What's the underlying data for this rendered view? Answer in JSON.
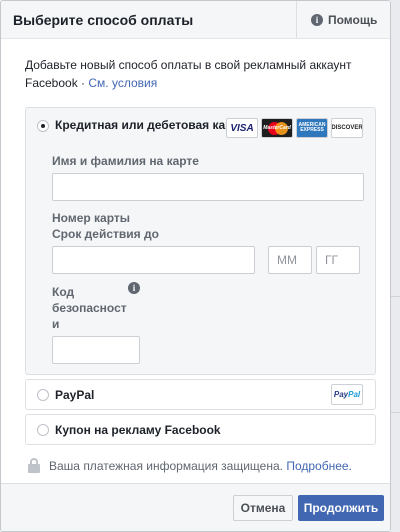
{
  "header": {
    "title": "Выберите способ оплаты",
    "help_label": "Помощь",
    "help_icon": "i"
  },
  "intro": {
    "text": "Добавьте новый способ оплаты в свой рекламный аккаунт Facebook · ",
    "terms_link": "См. условия"
  },
  "card_option": {
    "label": "Кредитная или дебетовая карта",
    "selected": true,
    "logos": {
      "visa": "VISA",
      "mastercard": "MasterCard",
      "amex_line1": "AMERICAN",
      "amex_line2": "EXPRESS",
      "discover": "DISCOVER"
    },
    "name_label": "Имя и фамилия на карте",
    "name_value": "",
    "number_label": "Номер карты",
    "expiry_label": "Срок действия до",
    "number_value": "",
    "month_placeholder": "ММ",
    "year_placeholder": "ГГ",
    "cvv_label_line1": "Код",
    "cvv_label_line2": "безопасност",
    "cvv_label_line3": "и",
    "cvv_value": "",
    "info_icon": "i"
  },
  "paypal_option": {
    "label": "PayPal",
    "selected": false,
    "logo_part1": "Pay",
    "logo_part2": "Pal"
  },
  "coupon_option": {
    "label": "Купон на рекламу Facebook",
    "selected": false
  },
  "security": {
    "text": "Ваша платежная информация защищена. ",
    "more_link": "Подробнее."
  },
  "footer": {
    "cancel_label": "Отмена",
    "continue_label": "Продолжить"
  },
  "colors": {
    "accent": "#4267b2",
    "header_bg": "#f5f6f7"
  }
}
